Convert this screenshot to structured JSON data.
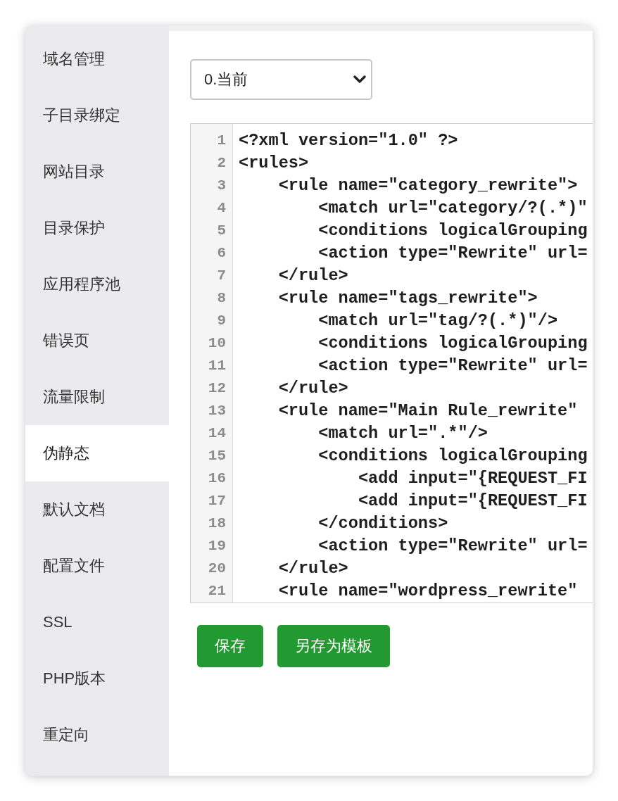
{
  "sidebar": {
    "items": [
      {
        "label": "域名管理",
        "selected": false
      },
      {
        "label": "子目录绑定",
        "selected": false
      },
      {
        "label": "网站目录",
        "selected": false
      },
      {
        "label": "目录保护",
        "selected": false
      },
      {
        "label": "应用程序池",
        "selected": false
      },
      {
        "label": "错误页",
        "selected": false
      },
      {
        "label": "流量限制",
        "selected": false
      },
      {
        "label": "伪静态",
        "selected": true
      },
      {
        "label": "默认文档",
        "selected": false
      },
      {
        "label": "配置文件",
        "selected": false
      },
      {
        "label": "SSL",
        "selected": false
      },
      {
        "label": "PHP版本",
        "selected": false
      },
      {
        "label": "重定向",
        "selected": false
      }
    ]
  },
  "version_select": {
    "value": "0.当前"
  },
  "editor": {
    "lines": [
      {
        "number": "1",
        "code": "<?xml version=\"1.0\" ?>"
      },
      {
        "number": "2",
        "code": "<rules>"
      },
      {
        "number": "3",
        "code": "    <rule name=\"category_rewrite\">"
      },
      {
        "number": "4",
        "code": "        <match url=\"category/?(.*)\""
      },
      {
        "number": "5",
        "code": "        <conditions logicalGrouping"
      },
      {
        "number": "6",
        "code": "        <action type=\"Rewrite\" url="
      },
      {
        "number": "7",
        "code": "    </rule>"
      },
      {
        "number": "8",
        "code": "    <rule name=\"tags_rewrite\">"
      },
      {
        "number": "9",
        "code": "        <match url=\"tag/?(.*)\"/>"
      },
      {
        "number": "10",
        "code": "        <conditions logicalGrouping"
      },
      {
        "number": "11",
        "code": "        <action type=\"Rewrite\" url="
      },
      {
        "number": "12",
        "code": "    </rule>"
      },
      {
        "number": "13",
        "code": "    <rule name=\"Main Rule_rewrite\""
      },
      {
        "number": "14",
        "code": "        <match url=\".*\"/>"
      },
      {
        "number": "15",
        "code": "        <conditions logicalGrouping"
      },
      {
        "number": "16",
        "code": "            <add input=\"{REQUEST_FI"
      },
      {
        "number": "17",
        "code": "            <add input=\"{REQUEST_FI"
      },
      {
        "number": "18",
        "code": "        </conditions>"
      },
      {
        "number": "19",
        "code": "        <action type=\"Rewrite\" url="
      },
      {
        "number": "20",
        "code": "    </rule>"
      },
      {
        "number": "21",
        "code": "    <rule name=\"wordpress_rewrite\""
      }
    ]
  },
  "buttons": [
    {
      "label": "保存"
    },
    {
      "label": "另存为模板"
    }
  ]
}
